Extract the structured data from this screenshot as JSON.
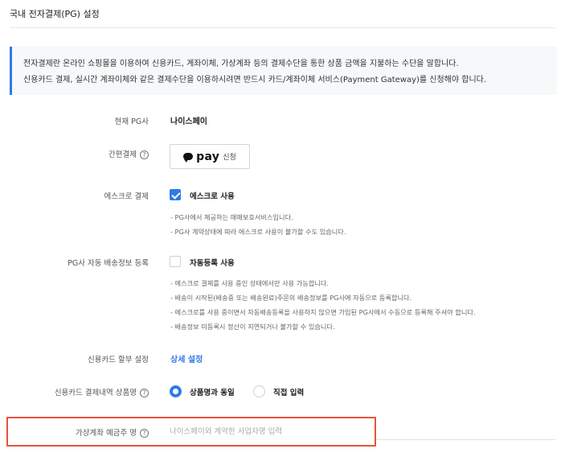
{
  "page": {
    "title": "국내 전자결제(PG) 설정"
  },
  "notice": {
    "line1": "전자결제란 온라인 쇼핑몰을 이용하여 신용카드, 계좌이체, 가상계좌 등의 결제수단을 통한 상품 금액을 지불하는 수단을 말합니다.",
    "line2": "신용카드 결제, 실시간 계좌이체와 같은 결제수단을 이용하시려면 반드시 카드/계좌이체 서비스(Payment Gateway)를 신청해야 합니다."
  },
  "current_pg": {
    "label": "현재 PG사",
    "value": "나이스페이"
  },
  "easy_pay": {
    "label": "간편결제",
    "help": "?",
    "brand_word": "pay",
    "apply_label": "신청",
    "icon": "speech-bubble-icon"
  },
  "escrow": {
    "label": "에스크로 결제",
    "checkbox_label": "에스크로 사용",
    "checked": true,
    "notes": [
      "- PG사에서 제공하는 매매보호서비스입니다.",
      "- PG사 계약상태에 따라 에스크로 사용이 불가할 수도 있습니다."
    ]
  },
  "auto_shipping": {
    "label": "PG사 자동 배송정보 등록",
    "checkbox_label": "자동등록 사용",
    "checked": false,
    "notes": [
      "- 에스크로 결제를 사용 중인 상태에서만 사용 가능합니다.",
      "- 배송이 시작된(배송중 또는 배송완료)주문의 배송정보를 PG사에 자동으로 등록합니다.",
      "- 에스크로를 사용 중이면서 자동배송등록을 사용하지 않으면 가입된 PG사에서 수동으로 등록해 주셔야 합니다.",
      "- 배송정보 미등록시 정산이 지연되거나 불가할 수 있습니다."
    ]
  },
  "installment": {
    "label": "신용카드 할부 설정",
    "link": "상세 설정"
  },
  "card_product_name": {
    "label": "신용카드 결제내역 상품명",
    "help": "?",
    "options": [
      "상품명과 동일",
      "직접 입력"
    ],
    "selected": "상품명과 동일"
  },
  "virtual_account": {
    "label": "가상계좌 예금주 명",
    "help": "?",
    "value": "",
    "placeholder": "나이스페이와 계약한 사업자명 입력"
  },
  "colors": {
    "accent": "#2f7be6",
    "highlight": "#e8523a"
  }
}
